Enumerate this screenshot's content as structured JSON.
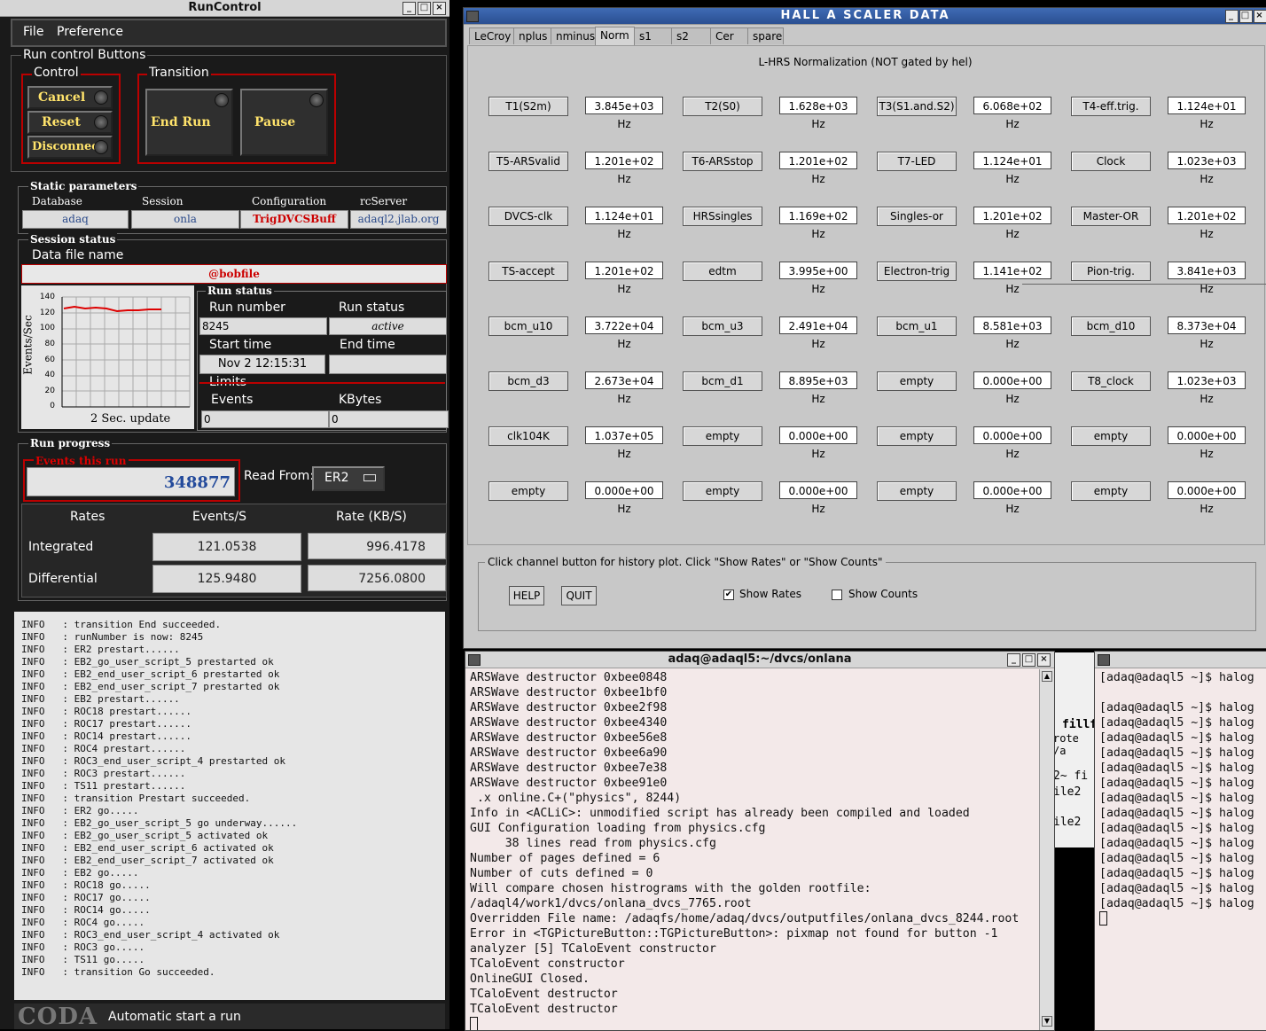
{
  "runcontrol": {
    "title": "RunControl",
    "menu": {
      "file": "File",
      "preference": "Preference"
    },
    "buttons_group": "Run control Buttons",
    "control_group": "Control",
    "control_buttons": [
      "Cancel",
      "Reset",
      "Disconnect"
    ],
    "transition_group": "Transition",
    "transition_buttons": [
      "End Run",
      "Pause"
    ],
    "static_params": {
      "title": "Static parameters",
      "database_label": "Database",
      "database": "adaq",
      "session_label": "Session",
      "session": "onla",
      "configuration_label": "Configuration",
      "configuration": "TrigDVCSBuff",
      "rcserver_label": "rcServer",
      "rcserver": "adaql2.jlab.org"
    },
    "session_status": {
      "title": "Session status",
      "data_file_label": "Data file name",
      "data_file": "@bobfile",
      "graph": {
        "ylabel": "Events/Sec",
        "caption": "2 Sec. update",
        "yticks": [
          "140",
          "120",
          "100",
          "80",
          "60",
          "40",
          "20",
          "0"
        ]
      },
      "run_status_title": "Run status",
      "run_number_label": "Run number",
      "run_number": "8245",
      "run_status_label": "Run status",
      "run_status": "active",
      "start_time_label": "Start time",
      "start_time": "Nov 2 12:15:31",
      "end_time_label": "End time",
      "end_time": "",
      "limits_label": "Limits",
      "events_label": "Events",
      "events": "0",
      "kbytes_label": "KBytes",
      "kbytes": "0"
    },
    "run_progress": {
      "title": "Run progress",
      "events_this_run_label": "Events this run",
      "events_this_run": "348877",
      "read_from_label": "Read From:",
      "read_from": "ER2",
      "col_rates": "Rates",
      "col_events": "Events/S",
      "col_rate": "Rate (KB/S)",
      "integrated_label": "Integrated",
      "integrated_events": "121.0538",
      "integrated_rate": "996.4178",
      "differential_label": "Differential",
      "differential_events": "125.9480",
      "differential_rate": "7256.0800"
    },
    "log": [
      "INFO   : transition End succeeded.",
      "INFO   : runNumber is now: 8245",
      "INFO   : ER2 prestart......",
      "INFO   : EB2_go_user_script_5 prestarted ok",
      "INFO   : EB2_end_user_script_6 prestarted ok",
      "INFO   : EB2_end_user_script_7 prestarted ok",
      "INFO   : EB2 prestart......",
      "INFO   : ROC18 prestart......",
      "INFO   : ROC17 prestart......",
      "INFO   : ROC14 prestart......",
      "INFO   : ROC4 prestart......",
      "INFO   : ROC3_end_user_script_4 prestarted ok",
      "INFO   : ROC3 prestart......",
      "INFO   : TS11 prestart......",
      "INFO   : transition Prestart succeeded.",
      "INFO   : ER2 go.....",
      "INFO   : EB2_go_user_script_5 go underway......",
      "INFO   : EB2_go_user_script_5 activated ok",
      "INFO   : EB2_end_user_script_6 activated ok",
      "INFO   : EB2_end_user_script_7 activated ok",
      "INFO   : EB2 go.....",
      "INFO   : ROC18 go.....",
      "INFO   : ROC17 go.....",
      "INFO   : ROC14 go.....",
      "INFO   : ROC4 go.....",
      "INFO   : ROC3_end_user_script_4 activated ok",
      "INFO   : ROC3 go.....",
      "INFO   : TS11 go.....",
      "INFO   : transition Go succeeded."
    ],
    "footer_logo": "CODA",
    "footer_status": "Automatic start a run"
  },
  "scaler": {
    "title": "HALL  A  SCALER  DATA",
    "tabs": [
      "LeCroy",
      "nplus",
      "nminus",
      "Norm",
      "s1",
      "s2",
      "Cer",
      "spare"
    ],
    "active_tab": "Norm",
    "subtitle": "L-HRS Normalization (NOT gated by hel)",
    "rows": [
      [
        [
          "T1(S2m)",
          "3.845e+03 Hz"
        ],
        [
          "T2(S0)",
          "1.628e+03 Hz"
        ],
        [
          "T3(S1.and.S2)",
          "6.068e+02 Hz"
        ],
        [
          "T4-eff.trig.",
          "1.124e+01 Hz"
        ]
      ],
      [
        [
          "T5-ARSvalid",
          "1.201e+02 Hz"
        ],
        [
          "T6-ARSstop",
          "1.201e+02 Hz"
        ],
        [
          "T7-LED",
          "1.124e+01 Hz"
        ],
        [
          "Clock",
          "1.023e+03 Hz"
        ]
      ],
      [
        [
          "DVCS-clk",
          "1.124e+01 Hz"
        ],
        [
          "HRSsingles",
          "1.169e+02 Hz"
        ],
        [
          "Singles-or",
          "1.201e+02 Hz"
        ],
        [
          "Master-OR",
          "1.201e+02 Hz"
        ]
      ],
      [
        [
          "TS-accept",
          "1.201e+02 Hz"
        ],
        [
          "edtm",
          "3.995e+00 Hz"
        ],
        [
          "Electron-trig",
          "1.141e+02 Hz"
        ],
        [
          "Pion-trig.",
          "3.841e+03 Hz"
        ]
      ],
      [
        [
          "bcm_u10",
          "3.722e+04 Hz"
        ],
        [
          "bcm_u3",
          "2.491e+04 Hz"
        ],
        [
          "bcm_u1",
          "8.581e+03 Hz"
        ],
        [
          "bcm_d10",
          "8.373e+04 Hz"
        ]
      ],
      [
        [
          "bcm_d3",
          "2.673e+04 Hz"
        ],
        [
          "bcm_d1",
          "8.895e+03 Hz"
        ],
        [
          "empty",
          "0.000e+00 Hz"
        ],
        [
          "T8_clock",
          "1.023e+03 Hz"
        ]
      ],
      [
        [
          "clk104K",
          "1.037e+05 Hz"
        ],
        [
          "empty",
          "0.000e+00 Hz"
        ],
        [
          "empty",
          "0.000e+00 Hz"
        ],
        [
          "empty",
          "0.000e+00 Hz"
        ]
      ],
      [
        [
          "empty",
          "0.000e+00 Hz"
        ],
        [
          "empty",
          "0.000e+00 Hz"
        ],
        [
          "empty",
          "0.000e+00 Hz"
        ],
        [
          "empty",
          "0.000e+00 Hz"
        ]
      ]
    ],
    "hint": "Click channel button for history plot.  Click \"Show Rates\" or \"Show Counts\"",
    "help_label": "HELP",
    "quit_label": "QUIT",
    "show_rates_label": "Show Rates",
    "show_rates_checked": true,
    "show_counts_label": "Show Counts",
    "show_counts_checked": false
  },
  "terminal1": {
    "title": "adaq@adaql5:~/dvcs/onlana",
    "lines": [
      "ARSWave destructor 0xbee0848",
      "ARSWave destructor 0xbee1bf0",
      "ARSWave destructor 0xbee2f98",
      "ARSWave destructor 0xbee4340",
      "ARSWave destructor 0xbee56e8",
      "ARSWave destructor 0xbee6a90",
      "ARSWave destructor 0xbee7e38",
      "ARSWave destructor 0xbee91e0",
      " .x online.C+(\"physics\", 8244)",
      "Info in <ACLiC>: unmodified script has already been compiled and loaded",
      "GUI Configuration loading from physics.cfg",
      "     38 lines read from physics.cfg",
      "Number of pages defined = 6",
      "Number of cuts defined = 0",
      "Will compare chosen histrograms with the golden rootfile:",
      "/adaql4/work1/dvcs/onlana_dvcs_7765.root",
      "Overridden File name: /adaqfs/home/adaq/dvcs/outputfiles/onlana_dvcs_8244.root",
      "Error in <TGPictureButton::TGPictureButton>: pixmap not found for button -1",
      "analyzer [5] TCaloEvent constructor",
      "TCaloEvent constructor",
      "OnlineGUI Closed.",
      "TCaloEvent destructor",
      "TCaloEvent destructor"
    ]
  },
  "terminal2": {
    "lines": [
      "[adaq@adaql5 ~]$ halog",
      "",
      "[adaq@adaql5 ~]$ halog",
      "[adaq@adaql5 ~]$ halog",
      "[adaq@adaql5 ~]$ halog",
      "[adaq@adaql5 ~]$ halog",
      "[adaq@adaql5 ~]$ halog",
      "[adaq@adaql5 ~]$ halog",
      "[adaq@adaql5 ~]$ halog",
      "[adaq@adaql5 ~]$ halog",
      "[adaq@adaql5 ~]$ halog",
      "[adaq@adaql5 ~]$ halog",
      "[adaq@adaql5 ~]$ halog",
      "[adaq@adaql5 ~]$ halog",
      "[adaq@adaql5 ~]$ halog",
      "[adaq@adaql5 ~]$ halog"
    ]
  },
  "background_fragments": [
    "fillf",
    "rote /a",
    "2~  fi",
    "ile2",
    "ile2"
  ]
}
